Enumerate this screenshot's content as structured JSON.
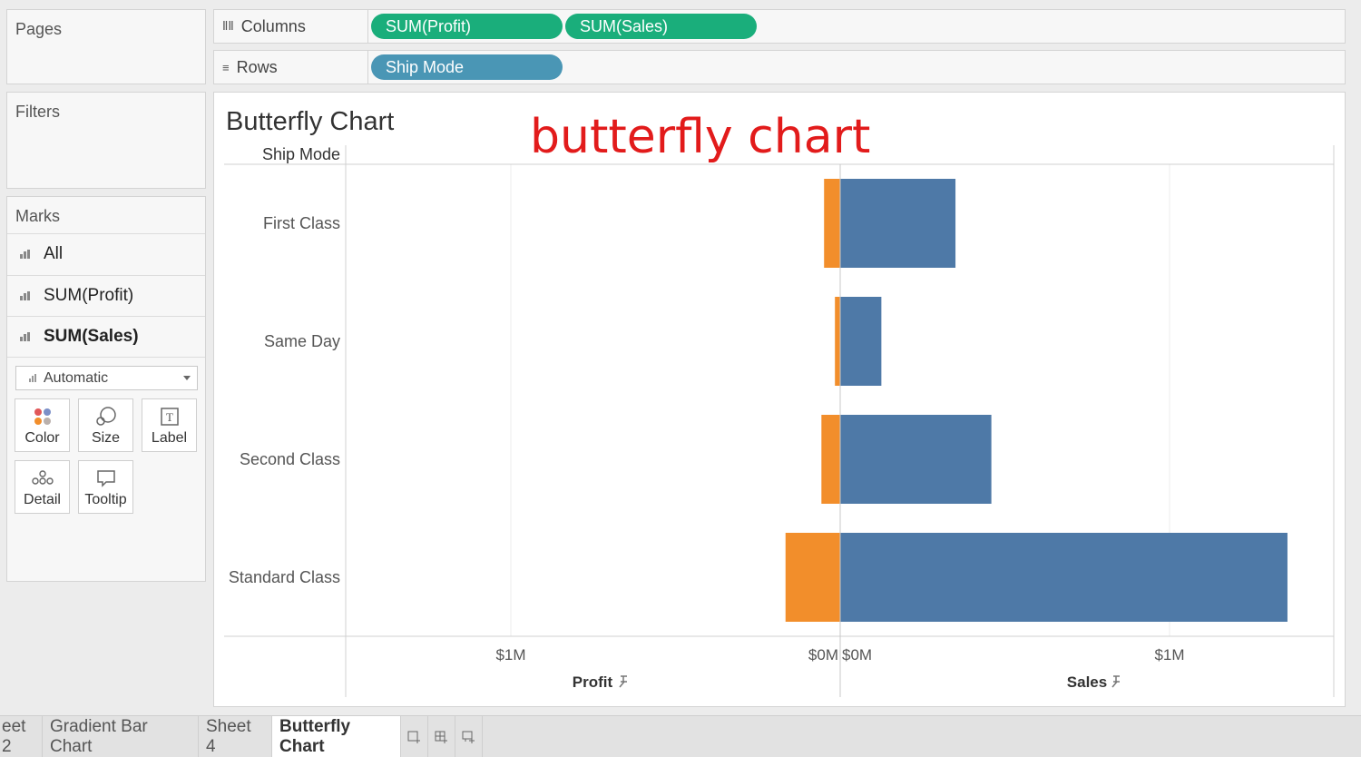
{
  "panels": {
    "pages": "Pages",
    "filters": "Filters",
    "marks": "Marks"
  },
  "marks": {
    "rows": [
      "All",
      "SUM(Profit)",
      "SUM(Sales)"
    ],
    "mark_type": "Automatic",
    "cards": [
      {
        "label": "Color",
        "icon": "color-icon"
      },
      {
        "label": "Size",
        "icon": "size-icon"
      },
      {
        "label": "Label",
        "icon": "label-icon"
      },
      {
        "label": "Detail",
        "icon": "detail-icon"
      },
      {
        "label": "Tooltip",
        "icon": "tooltip-icon"
      }
    ]
  },
  "shelves": {
    "columns_label": "Columns",
    "rows_label": "Rows",
    "columns_pills": [
      "SUM(Profit)",
      "SUM(Sales)"
    ],
    "rows_pills": [
      "Ship Mode"
    ]
  },
  "sheet_title": "Butterfly Chart",
  "annotation": "butterfly chart",
  "chart_data": {
    "type": "bar",
    "row_header": "Ship Mode",
    "categories": [
      "First Class",
      "Same Day",
      "Second Class",
      "Standard Class"
    ],
    "series": [
      {
        "name": "Profit",
        "values": [
          49000,
          16000,
          57000,
          166000
        ],
        "color": "#f28e2b",
        "direction": "left"
      },
      {
        "name": "Sales",
        "values": [
          350000,
          125000,
          459000,
          1358000
        ],
        "color": "#4e79a7",
        "direction": "right"
      }
    ],
    "profit_axis": {
      "title": "Profit",
      "ticks": [
        {
          "value": 1000000,
          "label": "$1M"
        },
        {
          "value": 0,
          "label": "$0M"
        }
      ]
    },
    "sales_axis": {
      "title": "Sales",
      "ticks": [
        {
          "value": 0,
          "label": "$0M"
        },
        {
          "value": 1000000,
          "label": "$1M"
        }
      ]
    },
    "xlim": [
      0,
      1500000
    ],
    "grid": true,
    "pin_icon": "pin-icon"
  },
  "tabs": {
    "items": [
      "eet 2",
      "Gradient Bar Chart",
      "Sheet 4",
      "Butterfly Chart"
    ],
    "active": "Butterfly Chart",
    "icons": [
      "new-worksheet-icon",
      "new-dashboard-icon",
      "new-story-icon"
    ]
  }
}
